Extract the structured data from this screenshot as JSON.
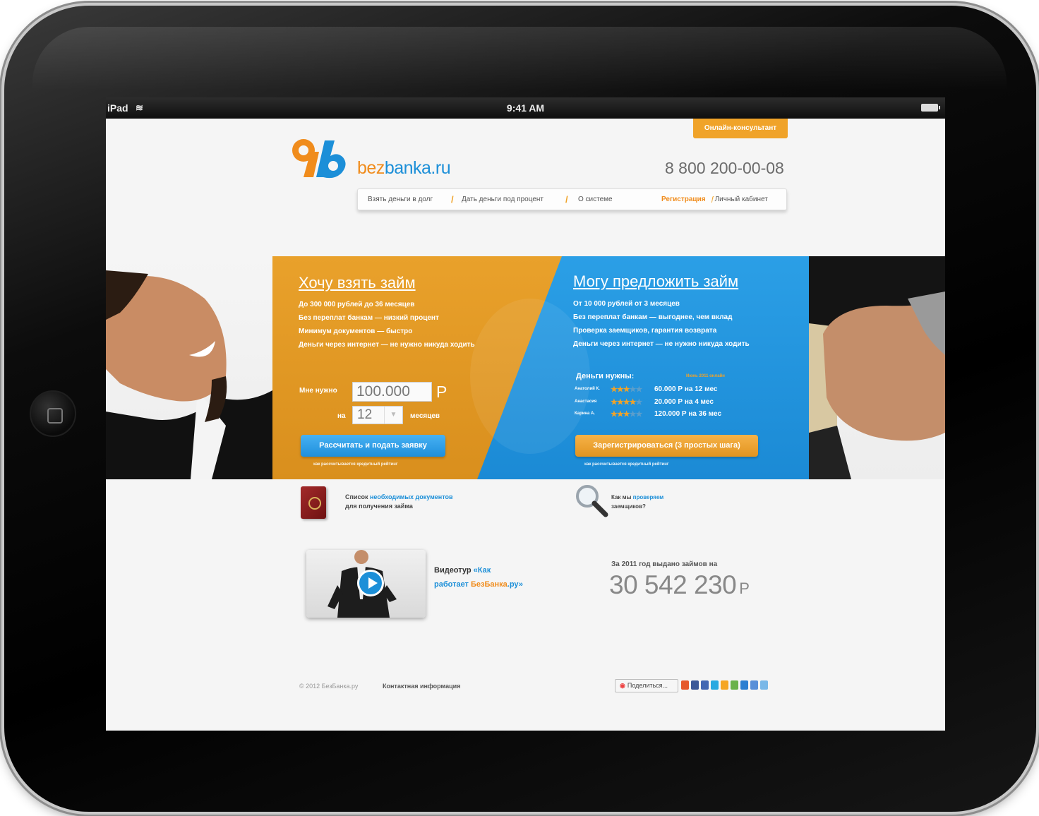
{
  "statusbar": {
    "device": "iPad",
    "time": "9:41 AM"
  },
  "consultant_button": "Онлайн-консультант",
  "logo": {
    "part1": "bez",
    "part2": "banka.ru"
  },
  "phone": "8 800 200-00-08",
  "nav": {
    "items": [
      "Взять деньги в долг",
      "Дать деньги под процент",
      "О системе"
    ],
    "register": "Регистрация",
    "cabinet": "Личный кабинет"
  },
  "borrow": {
    "title": "Хочу взять займ",
    "lines": [
      "До 300 000 рублей до 36 месяцев",
      "Без переплат банкам — низкий процент",
      "Минимум документов — быстро",
      "Деньги через интернет — не нужно никуда ходить"
    ],
    "need_label": "Мне нужно",
    "amount": "100.000",
    "currency": "Р",
    "on_label": "на",
    "months": "12",
    "months_label": "месяцев",
    "button": "Рассчитать и подать заявку",
    "small_link": "как рассчитывается кредитный рейтинг"
  },
  "lend": {
    "title": "Могу предложить займ",
    "lines": [
      "От 10 000 рублей от 3 месяцев",
      "Без переплат банкам — выгоднее, чем вклад",
      "Проверка заемщиков, гарантия возврата",
      "Деньги через интернет — не нужно никуда ходить"
    ],
    "demand_title": "Деньги нужны:",
    "demand_date": "Июнь 2011 онлайн",
    "demand_rows": [
      {
        "name": "Анатолий К.",
        "stars": "★★★",
        "stars_off": "★★",
        "amount": "60.000 Р на 12 мес"
      },
      {
        "name": "Анастасия",
        "stars": "★★★★",
        "stars_off": "★",
        "amount": "20.000 Р на 4 мес"
      },
      {
        "name": "Карина А.",
        "stars": "★★★",
        "stars_off": "★★",
        "amount": "120.000 Р на 36 мес"
      }
    ],
    "button": "Зарегистрироваться (3 простых шага)",
    "small_link": "как рассчитывается кредитный рейтинг"
  },
  "docs": {
    "prefix": "Список ",
    "link": "необходимых документов",
    "line2": "для получения займа"
  },
  "check": {
    "prefix": "Как мы ",
    "link": "проверяем",
    "line2": "заемщиков?"
  },
  "video": {
    "prefix": "Видеотур ",
    "link1": "«Как",
    "link2a": "работает ",
    "link2b": "БезБанка",
    "link2c": ".ру»"
  },
  "stats": {
    "label": "За 2011 год выдано займов на",
    "value": "30 542 230",
    "currency": "Р"
  },
  "footer": {
    "copyright": "© 2012 БезБанка.ру",
    "contact": "Контактная информация",
    "share": "Поделиться..."
  },
  "colors": {
    "orange": "#e9a12b",
    "blue": "#2b9fe6",
    "link": "#1c8fd8"
  }
}
